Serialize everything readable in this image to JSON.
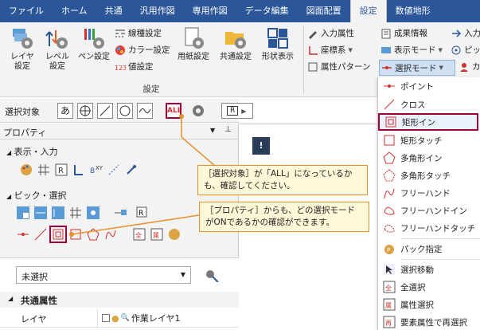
{
  "menubar": {
    "tabs": [
      "ファイル",
      "ホーム",
      "共通",
      "汎用作図",
      "専用作図",
      "データ編集",
      "図面配置",
      "設定",
      "数値地形"
    ],
    "active": "設定"
  },
  "ribbon": {
    "layer_settings": "レイヤ\n設定",
    "level_settings": "レベル\n設定",
    "pen_settings": "ペン設定",
    "line_type": "線種設定",
    "color_settings": "カラー設定",
    "value_settings": "値設定",
    "paper_settings": "用紙設定",
    "common_settings": "共通設定",
    "shape_display": "形状表示",
    "group_label": "設定",
    "input_attributes": "入力属性",
    "coordinate_system": "座標系",
    "attribute_pattern": "属性パターン",
    "result_info": "成果情報",
    "display_mode": "表示モード",
    "select_mode": "選択モード",
    "input_short": "入力",
    "pick_short": "ピック",
    "custom_short": "カスタ"
  },
  "select_toolbar": {
    "label": "選択対象",
    "btn_a": "あ",
    "btn_all": "ALL",
    "btn_r": "R"
  },
  "property_panel": {
    "title": "プロパティ",
    "display_input": "表示・入力",
    "pick_select": "ピック・選択",
    "dropdown_value": "未選択",
    "common_attributes": "共通属性",
    "layer_label": "レイヤ",
    "layer_value": "作業レイヤ1"
  },
  "select_menu": {
    "items": [
      {
        "label": "ポイント",
        "icon": "point-icon"
      },
      {
        "label": "クロス",
        "icon": "cross-icon"
      },
      {
        "label": "矩形イン",
        "icon": "rect-in-icon",
        "highlighted": true
      },
      {
        "label": "矩形タッチ",
        "icon": "rect-touch-icon"
      },
      {
        "label": "多角形イン",
        "icon": "polygon-in-icon"
      },
      {
        "label": "多角形タッチ",
        "icon": "polygon-touch-icon"
      },
      {
        "label": "フリーハンド",
        "icon": "freehand-icon"
      },
      {
        "label": "フリーハンドイン",
        "icon": "freehand-in-icon"
      },
      {
        "label": "フリーハンドタッチ",
        "icon": "freehand-touch-icon"
      },
      {
        "label": "パック指定",
        "icon": "pack-icon"
      },
      {
        "label": "選択移動",
        "icon": "select-move-icon"
      },
      {
        "label": "全選択",
        "icon": "select-all-icon"
      },
      {
        "label": "属性選択",
        "icon": "attribute-select-icon"
      },
      {
        "label": "要素属性で再選択",
        "icon": "reselect-icon"
      }
    ]
  },
  "callouts": {
    "all_note": "［選択対象］が「ALL」になっているかも、確認してください。",
    "property_note": "［プロパティ］からも、どの選択モードがONであるかの確認ができます。"
  },
  "colors": {
    "accent": "#2b579a",
    "highlight": "#a0003c",
    "callout_border": "#e8902a"
  }
}
